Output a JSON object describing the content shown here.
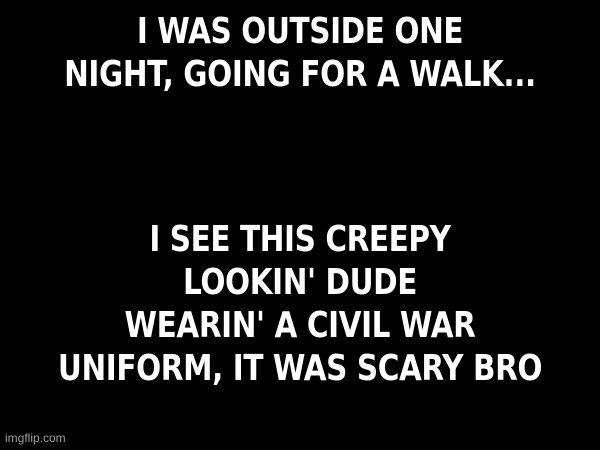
{
  "meme": {
    "background": "#000000",
    "text_color": "#ffffff",
    "top_caption": {
      "lines": [
        "I WAS OUTSIDE ONE",
        "NIGHT, GOING FOR A WALK..."
      ]
    },
    "bottom_caption": {
      "lines": [
        "I SEE THIS CREEPY",
        "LOOKIN' DUDE",
        "WEARIN' A CIVIL WAR",
        "UNIFORM, IT WAS SCARY BRO"
      ]
    },
    "watermark": "imgflip.com"
  }
}
